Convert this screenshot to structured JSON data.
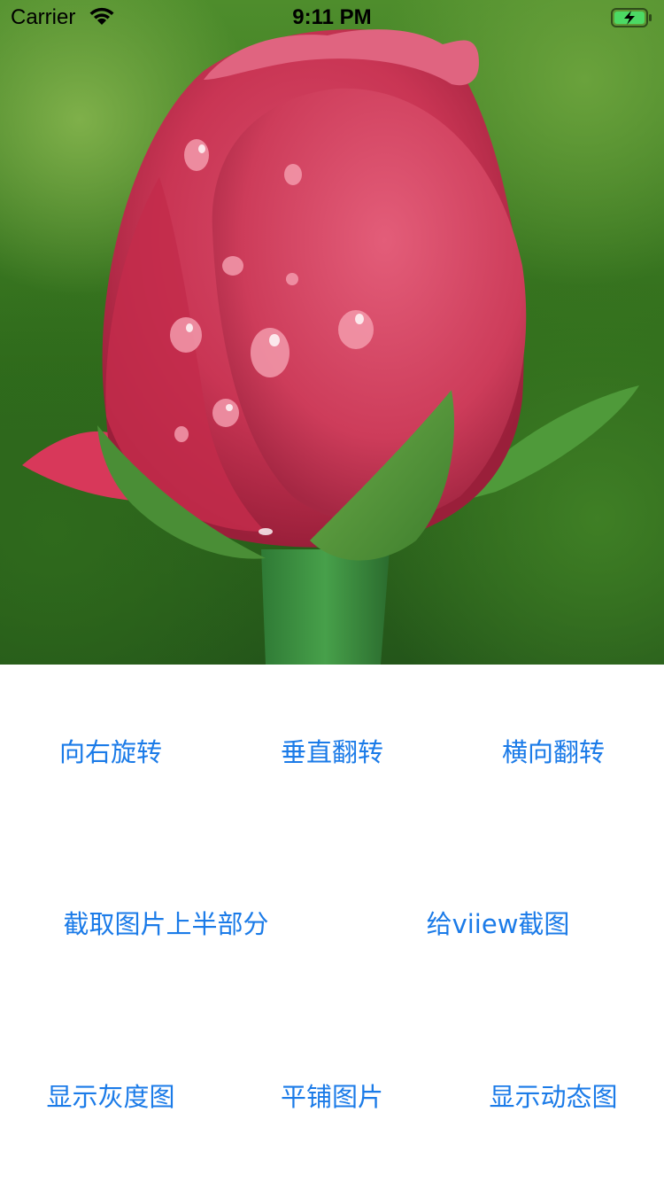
{
  "status_bar": {
    "carrier": "Carrier",
    "time": "9:11 PM",
    "wifi_icon": "wifi-icon",
    "battery_icon": "battery-charging-icon"
  },
  "image": {
    "subject": "rose-bud-photo"
  },
  "buttons": {
    "rotate_right": "向右旋转",
    "flip_vertical": "垂直翻转",
    "flip_horizontal": "横向翻转",
    "crop_top_half": "截取图片上半部分",
    "view_snapshot": "给viiew截图",
    "grayscale": "显示灰度图",
    "tile_image": "平铺图片",
    "animated_image": "显示动态图"
  },
  "colors": {
    "button_text": "#1b7be8",
    "background": "#ffffff"
  }
}
